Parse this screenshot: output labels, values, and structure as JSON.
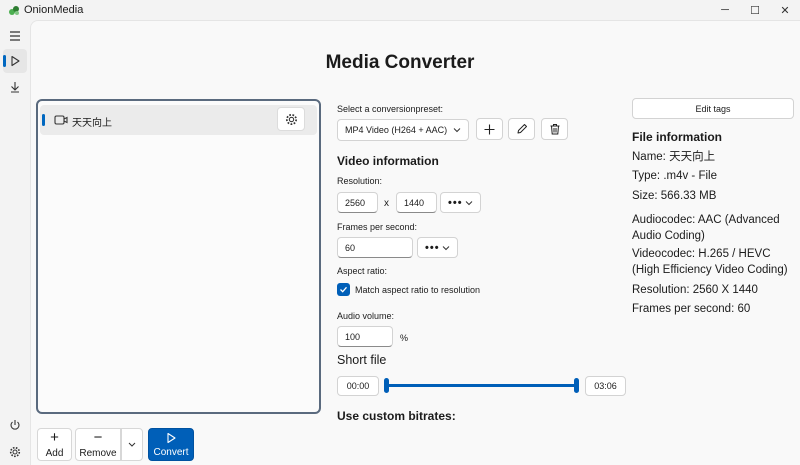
{
  "app": {
    "title": "OnionMedia"
  },
  "window": {
    "minimize_icon": "─",
    "maximize_icon": "☐",
    "close_icon": "✕"
  },
  "page": {
    "title": "Media Converter"
  },
  "file_list": {
    "items": [
      {
        "name": "天天向上"
      }
    ]
  },
  "bottom_toolbar": {
    "add_label": "Add",
    "remove_label": "Remove",
    "convert_label": "Convert"
  },
  "conversion": {
    "preset_label": "Select a conversionpreset:",
    "preset_value": "MP4 Video (H264 + AAC)"
  },
  "video_information": {
    "heading": "Video information",
    "resolution_label": "Resolution:",
    "width": "2560",
    "separator": "x",
    "height": "1440",
    "more_options": "•••",
    "fps_label": "Frames per second:",
    "fps": "60",
    "aspect_label": "Aspect ratio:",
    "aspect_checkbox_label": "Match aspect ratio to resolution",
    "aspect_checked": true,
    "volume_label": "Audio volume:",
    "volume": "100",
    "volume_unit": "%"
  },
  "short_file": {
    "heading": "Short file",
    "start_time": "00:00",
    "end_time": "03:06",
    "range_start_fraction": 0.0,
    "range_end_fraction": 1.0
  },
  "custom_bitrates": {
    "heading": "Use custom bitrates:"
  },
  "file_information": {
    "edit_tags_label": "Edit tags",
    "heading": "File information",
    "name": "Name: 天天向上",
    "type": "Type: .m4v - File",
    "size": "Size: 566.33 MB",
    "audiocodec": "Audiocodec: AAC (Advanced Audio Coding)",
    "videocodec": "Videocodec: H.265 / HEVC (High Efficiency Video Coding)",
    "resolution": "Resolution: 2560 X 1440",
    "fps": "Frames per second: 60"
  },
  "colors": {
    "accent": "#005fb8",
    "panel_border": "#5a6a7e"
  }
}
